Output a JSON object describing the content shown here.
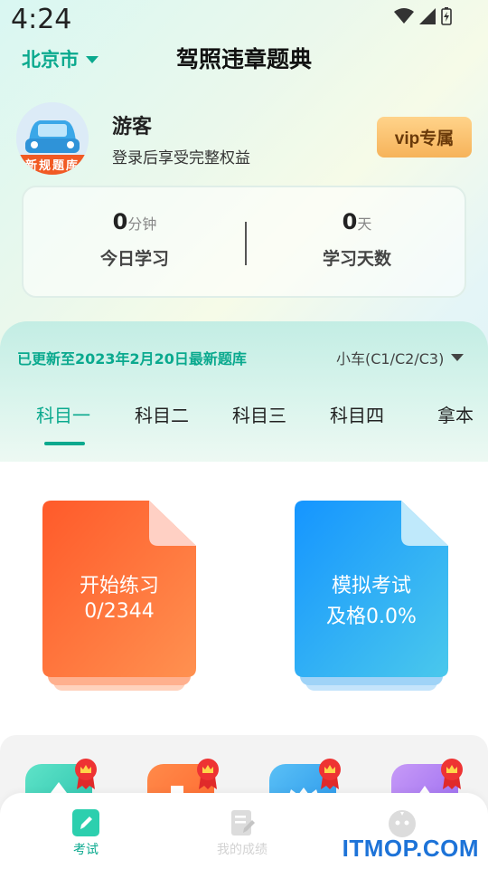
{
  "status_bar": {
    "time": "4:24"
  },
  "header": {
    "city": "北京市",
    "title": "驾照违章题典"
  },
  "user": {
    "name": "游客",
    "subtitle": "登录后享受完整权益",
    "avatar_text": "新规题库",
    "vip_label": "vip专属"
  },
  "stats": [
    {
      "value": "0",
      "unit": "分钟",
      "label": "今日学习"
    },
    {
      "value": "0",
      "unit": "天",
      "label": "学习天数"
    }
  ],
  "question_bank": {
    "update_text": "已更新至2023年2月20日最新题库",
    "car_type": "小车(C1/C2/C3)",
    "tabs": [
      "科目一",
      "科目二",
      "科目三",
      "科目四",
      "拿本"
    ],
    "active_tab": 0
  },
  "cards": {
    "practice": {
      "title": "开始练习",
      "progress": "0/2344",
      "color_from": "#ff5a2a",
      "color_to": "#ff8c4a"
    },
    "exam": {
      "title": "模拟考试",
      "pass_rate": "及格0.0%",
      "color_from": "#1a9bff",
      "color_to": "#48c3ee"
    }
  },
  "tools": [
    {
      "icon": "upload-icon",
      "color": "#3ed3b8"
    },
    {
      "icon": "document-icon",
      "color": "#ff7a3a"
    },
    {
      "icon": "crown-icon",
      "color": "#2fa8ee"
    },
    {
      "icon": "star-icon",
      "color": "#b07af0"
    }
  ],
  "bottom_nav": [
    {
      "label": "考试",
      "icon": "pencil-icon",
      "active": true
    },
    {
      "label": "我的成绩",
      "icon": "score-icon",
      "active": false
    },
    {
      "label": "",
      "icon": "profile-icon",
      "active": false
    }
  ],
  "watermark": "ITMOP.COM",
  "colors": {
    "accent": "#0aa98e",
    "vip": "#f6b35a"
  }
}
